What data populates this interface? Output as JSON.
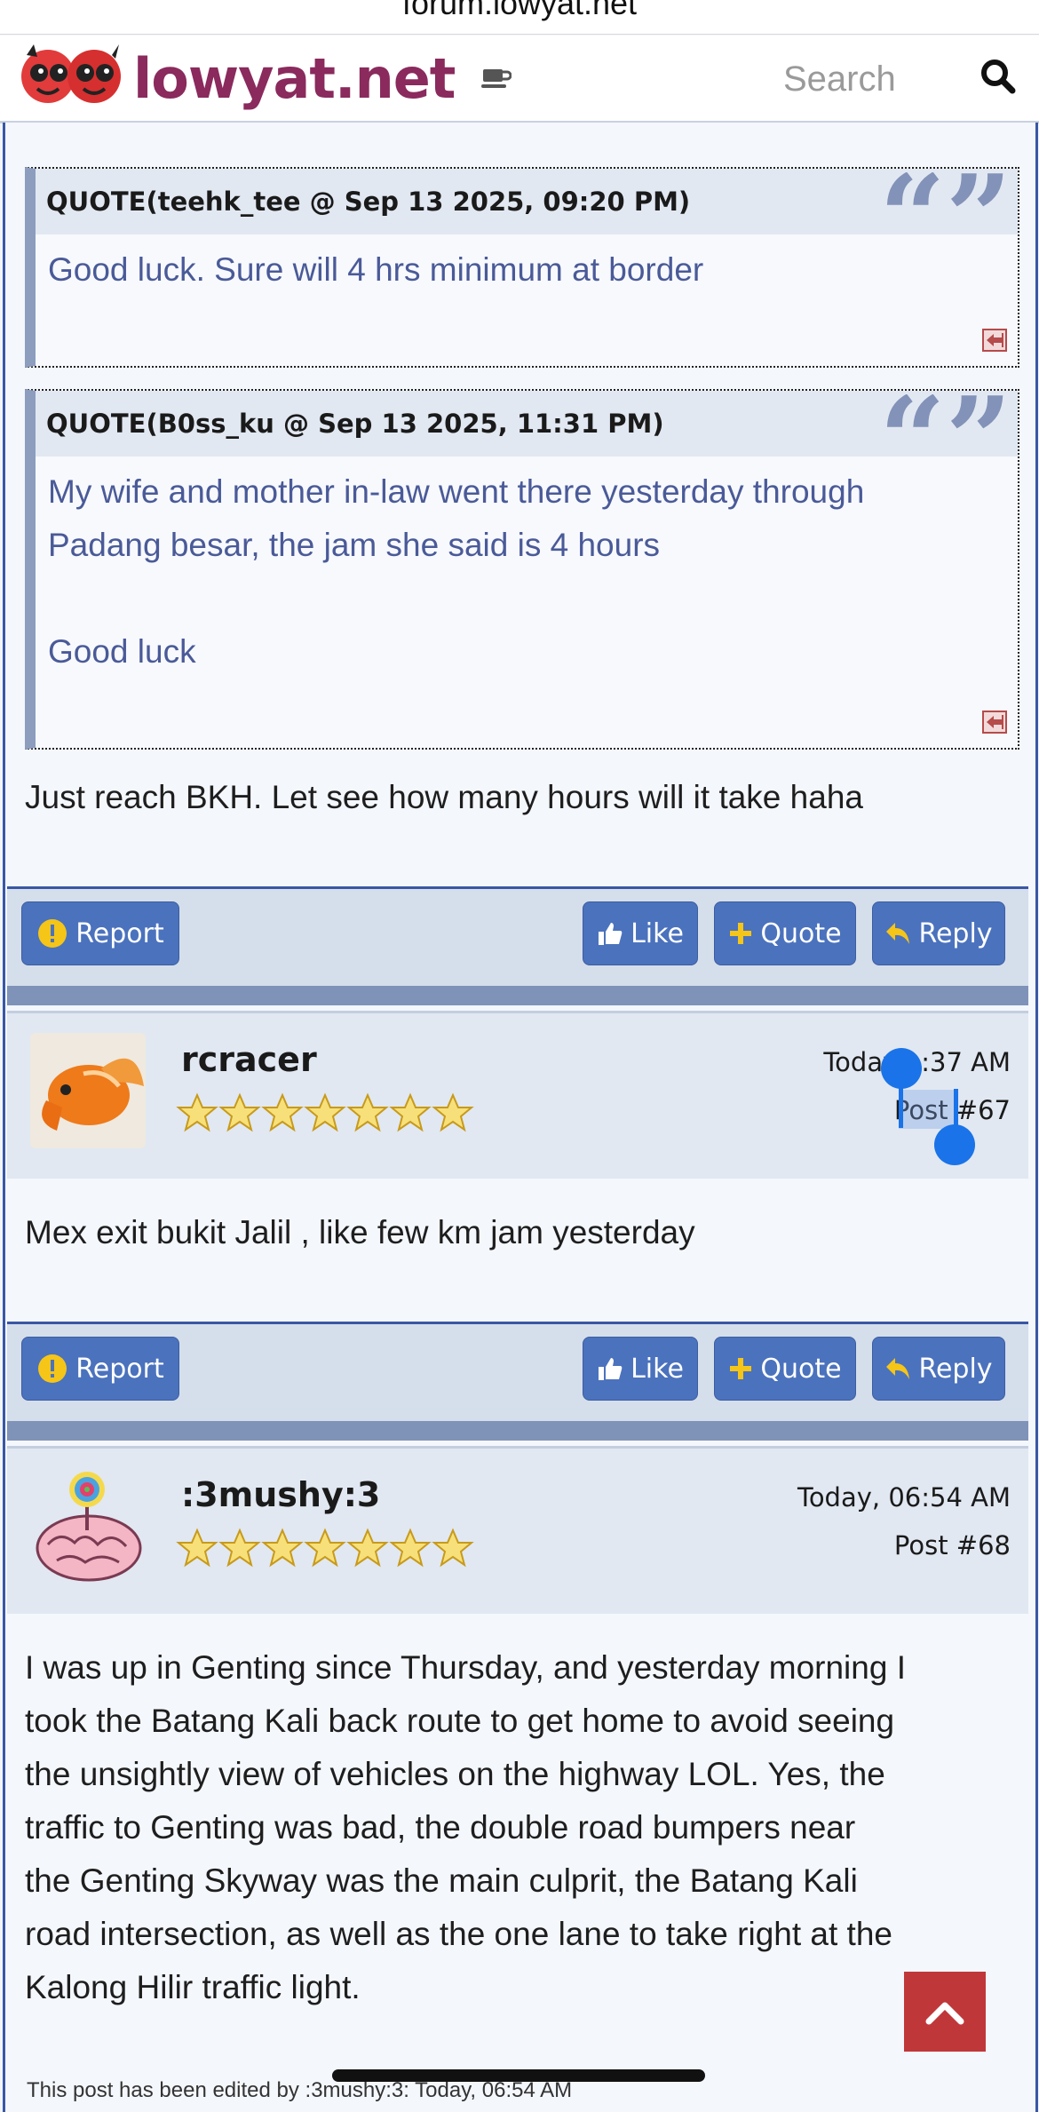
{
  "browser": {
    "url": "forum.lowyat.net"
  },
  "header": {
    "logo_text": "lowyat.net",
    "search_placeholder": "Search"
  },
  "post66": {
    "quotes": [
      {
        "header": "QUOTE(teehk_tee @ Sep 13 2025, 09:20 PM)",
        "lines": [
          "Good luck. Sure will 4 hrs minimum at border"
        ]
      },
      {
        "header": "QUOTE(B0ss_ku @ Sep 13 2025, 11:31 PM)",
        "lines": [
          "My wife and mother in-law went there yesterday through",
          "Padang besar, the jam she said is 4 hours",
          "",
          "Good luck"
        ]
      }
    ],
    "text": "Just reach BKH. Let see how many hours will it take haha"
  },
  "actions": {
    "report": "Report",
    "like": "Like",
    "quote": "Quote",
    "reply": "Reply"
  },
  "post67": {
    "username": "rcracer",
    "date": "Today, 06:37 AM",
    "date_visible_prefix": "Today",
    "date_visible_suffix": ":37 AM",
    "post_number": "Post #67",
    "stars": 7,
    "text": "Mex exit bukit Jalil , like few km jam yesterday"
  },
  "post68": {
    "username": ":3mushy:3",
    "date": "Today, 06:54 AM",
    "post_number": "Post #68",
    "stars": 7,
    "text_lines": [
      "I was up in Genting since Thursday, and yesterday morning I",
      "took the Batang Kali back route to get home to avoid seeing",
      "the unsightly view of vehicles on the highway LOL. Yes, the",
      "traffic to Genting was bad, the double road bumpers near",
      "the Genting Skyway was the main culprit, the Batang Kali",
      "road intersection, as well as the one lane to take right at the",
      "Kalong Hilir traffic light."
    ],
    "edited_note": "This post has been edited by :3mushy:3: Today, 06:54 AM"
  },
  "colors": {
    "brand": "#8a2a5d",
    "button": "#4b72bd",
    "frame": "#3a57a4",
    "scroll_top": "#c0373a"
  }
}
